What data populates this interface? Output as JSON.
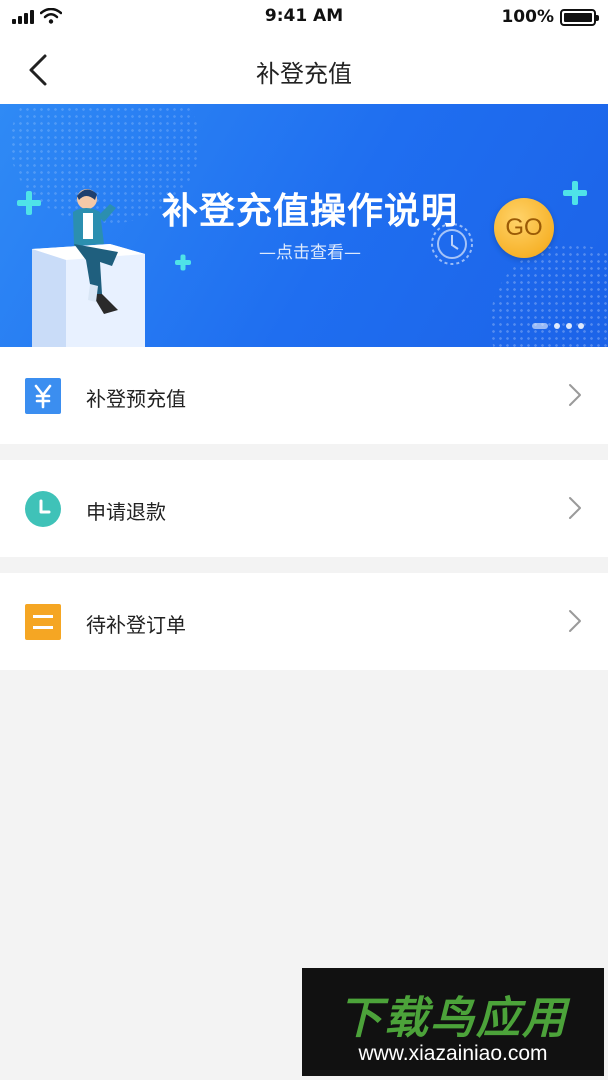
{
  "status_bar": {
    "time": "9:41 AM",
    "battery": "100%"
  },
  "nav": {
    "title": "补登充值",
    "back_icon": "chevron-left-icon"
  },
  "banner": {
    "title": "补登充值操作说明",
    "subtitle": "—点击查看—",
    "go_label": "GO",
    "page_count": 4,
    "active_page": 1
  },
  "menu": [
    {
      "label": "补登预充值",
      "icon": "yen-icon",
      "color": "#3b8ef0"
    },
    {
      "label": "申请退款",
      "icon": "clock-icon",
      "color": "#3fc2b8"
    },
    {
      "label": "待补登订单",
      "icon": "list-icon",
      "color": "#f5a623"
    }
  ],
  "watermark": {
    "title": "下载鸟应用",
    "url": "www.xiazainiao.com"
  }
}
